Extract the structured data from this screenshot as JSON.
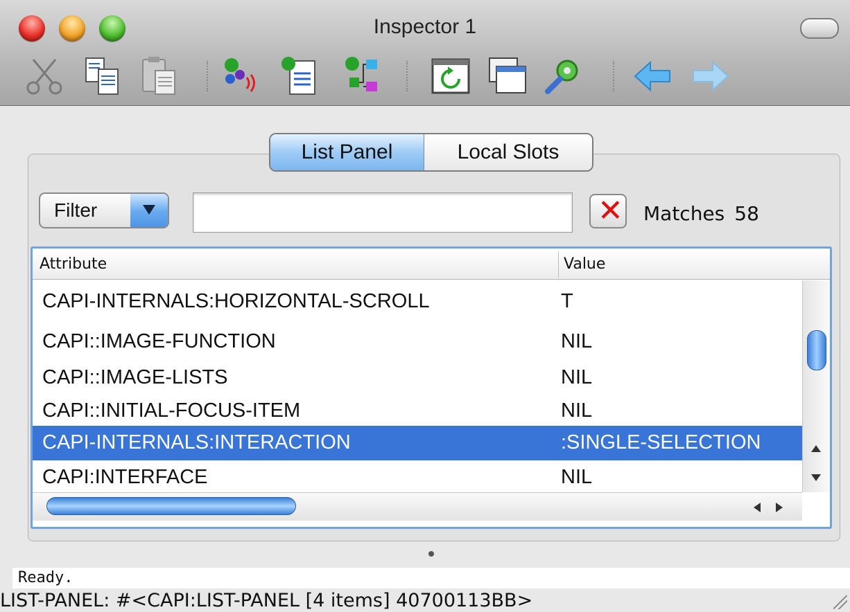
{
  "window": {
    "title": "Inspector 1"
  },
  "toolbar": {
    "items": [
      "cut-icon",
      "copy-icon",
      "paste-icon",
      "signal-objects-icon",
      "inspect-list-icon",
      "hierarchy-icon",
      "refresh-icon",
      "window-icon",
      "settings-icon",
      "back-arrow-icon",
      "forward-arrow-icon"
    ]
  },
  "tabs": [
    {
      "label": "List Panel",
      "active": true
    },
    {
      "label": "Local Slots",
      "active": false
    }
  ],
  "filter": {
    "dropdown_label": "Filter",
    "input_value": "",
    "clear_icon": "close-x-icon",
    "matches_label": "Matches",
    "matches_count": "58"
  },
  "table": {
    "columns": [
      "Attribute",
      "Value"
    ],
    "rows": [
      {
        "attribute": "CAPI-INTERNALS:HORIZONTAL-SCROLL",
        "value": "T",
        "selected": false
      },
      {
        "attribute": "CAPI::IMAGE-FUNCTION",
        "value": "NIL",
        "selected": false
      },
      {
        "attribute": "CAPI::IMAGE-LISTS",
        "value": "NIL",
        "selected": false
      },
      {
        "attribute": "CAPI::INITIAL-FOCUS-ITEM",
        "value": "NIL",
        "selected": false
      },
      {
        "attribute": "CAPI-INTERNALS:INTERACTION",
        "value": ":SINGLE-SELECTION",
        "selected": true
      },
      {
        "attribute": "CAPI:INTERFACE",
        "value": "NIL",
        "selected": false
      }
    ]
  },
  "status": {
    "message": "Ready.",
    "description": "LIST-PANEL: #<CAPI:LIST-PANEL [4 items] 40700113BB>"
  },
  "colors": {
    "selection": "#3875d7",
    "focus_ring": "#6fa4de",
    "clear_x": "#e01010"
  }
}
